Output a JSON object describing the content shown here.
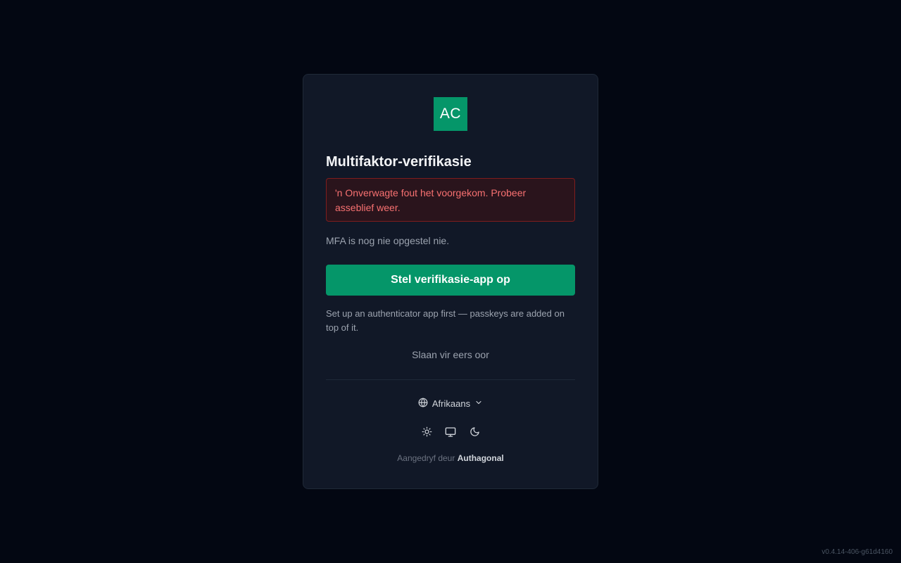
{
  "logo": {
    "text": "AC",
    "color": "#059669"
  },
  "title": "Multifaktor-verifikasie",
  "error": {
    "message": "'n Onverwagte fout het voorgekom. Probeer asseblief weer."
  },
  "status_text": "MFA is nog nie opgestel nie.",
  "setup_button": {
    "label": "Stel verifikasie-app op"
  },
  "hint": "Set up an authenticator app first — passkeys are added on top of it.",
  "skip_link": {
    "label": "Slaan vir eers oor"
  },
  "language": {
    "selected": "Afrikaans",
    "icon": "globe-icon"
  },
  "theme_options": [
    {
      "name": "light",
      "icon": "sun-icon"
    },
    {
      "name": "system",
      "icon": "monitor-icon"
    },
    {
      "name": "dark",
      "icon": "moon-icon"
    }
  ],
  "footer": {
    "powered_prefix": "Aangedryf deur",
    "brand": "Authagonal"
  },
  "version": "v0.4.14-406-g61d4160",
  "colors": {
    "accent": "#059669",
    "error": "#f87171",
    "background": "#030712",
    "card": "#111827"
  }
}
